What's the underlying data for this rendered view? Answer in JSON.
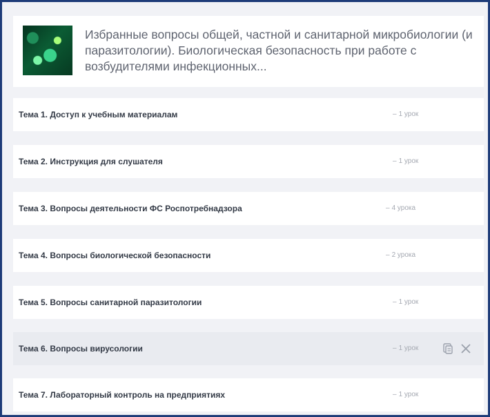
{
  "course": {
    "title": "Избранные вопросы общей, частной и санитарной микробиологии (и паразитологии). Биологическая безопасность при работе с возбудителями инфекционных..."
  },
  "topics": [
    {
      "title": "Тема 1. Доступ к учебным материалам",
      "lessons": "1 урок"
    },
    {
      "title": "Тема 2. Инструкция для слушателя",
      "lessons": "1 урок"
    },
    {
      "title": "Тема 3. Вопросы деятельности ФС Роспотребнадзора",
      "lessons": "4 урока"
    },
    {
      "title": "Тема 4. Вопросы биологической безопасности",
      "lessons": "2 урока"
    },
    {
      "title": "Тема 5. Вопросы санитарной паразитологии",
      "lessons": "1 урок"
    },
    {
      "title": "Тема 6. Вопросы вирусологии",
      "lessons": "1 урок"
    },
    {
      "title": "Тема 7. Лабораторный контроль на предприятиях",
      "lessons": "1 урок"
    }
  ],
  "lesson_prefix": "–",
  "icons": {
    "course_image": "microbiology-image",
    "copy": "copy-icon",
    "close": "close-icon"
  },
  "colors": {
    "border": "#1d3b78",
    "background": "#f1f2f6",
    "row_hover": "#e9ebf0",
    "title_text": "#333a46",
    "muted_text": "#a4a8b1"
  }
}
